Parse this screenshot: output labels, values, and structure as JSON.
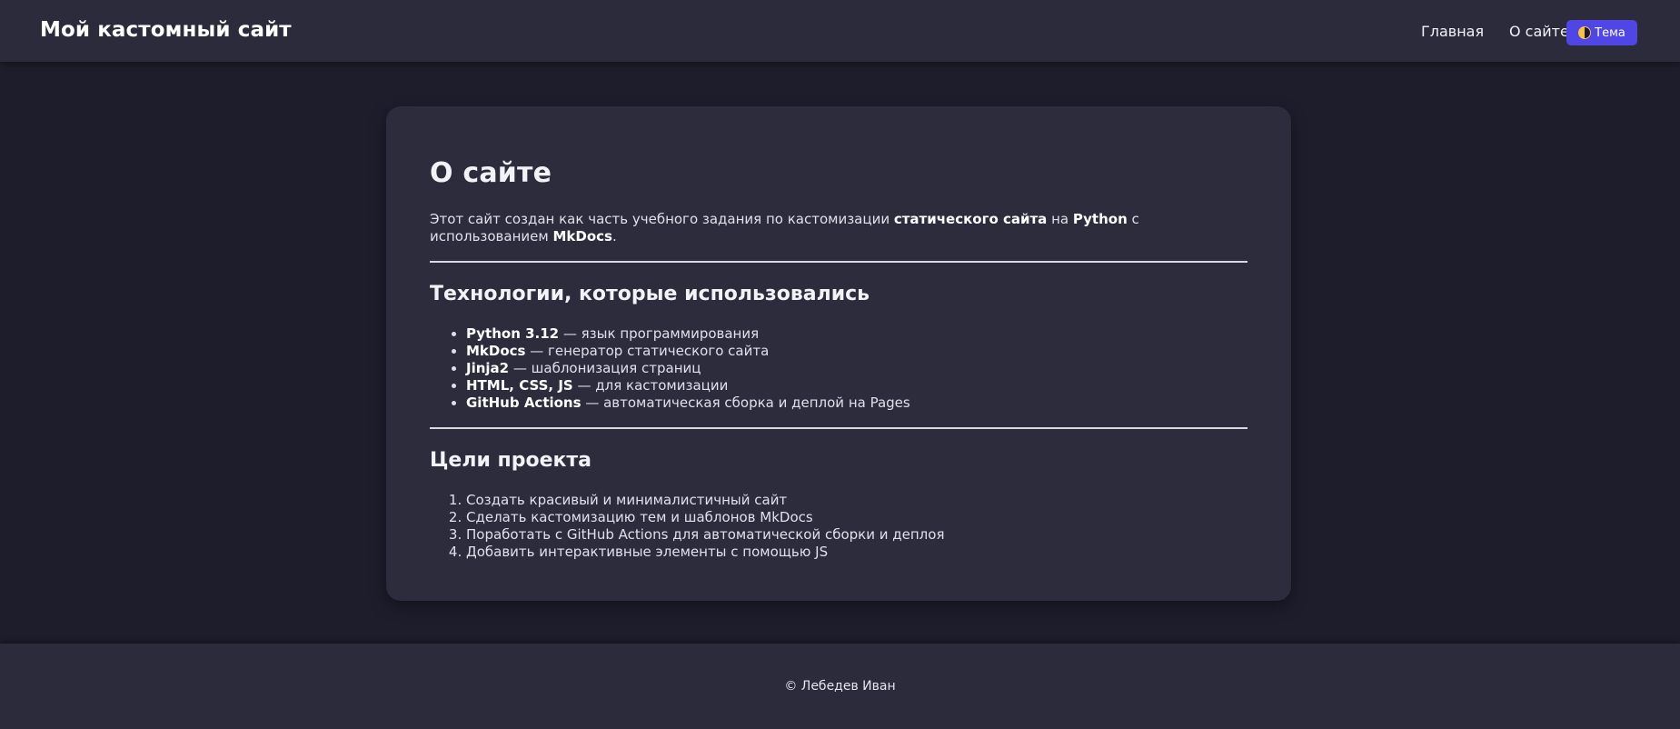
{
  "header": {
    "site_title": "Мой кастомный сайт",
    "nav": [
      {
        "label": "Главная"
      },
      {
        "label": "О сайте"
      }
    ],
    "theme_button": {
      "label": "Тема",
      "icon": "half-moon-icon",
      "color": "#5046e5"
    }
  },
  "main": {
    "title": "О сайте",
    "intro": {
      "t1": "Этот сайт создан как часть учебного задания по кастомизации ",
      "b1": "статического сайта",
      "t2": " на ",
      "b2": "Python",
      "t3": " с использованием ",
      "b3": "MkDocs",
      "t4": "."
    },
    "tech_heading": "Технологии, которые использовались",
    "technologies": [
      {
        "name": "Python 3.12",
        "desc": " — язык программирования"
      },
      {
        "name": "MkDocs",
        "desc": " — генератор статического сайта"
      },
      {
        "name": "Jinja2",
        "desc": " — шаблонизация страниц"
      },
      {
        "name": "HTML, CSS, JS",
        "desc": " — для кастомизации"
      },
      {
        "name": "GitHub Actions",
        "desc": " — автоматическая сборка и деплой на Pages"
      }
    ],
    "goals_heading": "Цели проекта",
    "goals": [
      "Создать красивый и минималистичный сайт",
      "Сделать кастомизацию тем и шаблонов MkDocs",
      "Поработать с GitHub Actions для автоматической сборки и деплоя",
      "Добавить интерактивные элементы с помощью JS"
    ]
  },
  "footer": {
    "copyright": "© Лебедев Иван"
  },
  "colors": {
    "background": "#1e1d2c",
    "surface": "#2d2c3c",
    "accent": "#5046e5"
  }
}
